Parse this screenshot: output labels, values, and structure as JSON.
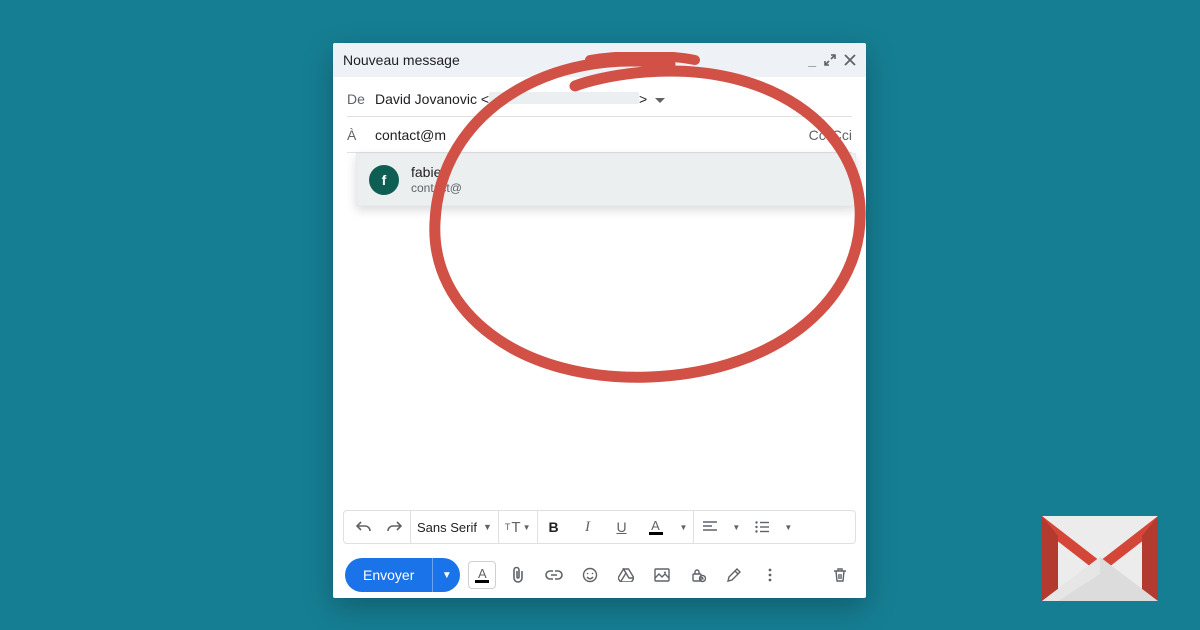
{
  "compose": {
    "title": "Nouveau message",
    "from_label": "De",
    "from_name": "David Jovanovic",
    "from_bracket_open": "<",
    "from_bracket_close": ">",
    "to_label": "À",
    "to_value": "contact@m",
    "cc_label": "Cc",
    "bcc_label": "Cci",
    "suggestion": {
      "avatar_initial": "f",
      "name": "fabien",
      "email_prefix": "contact@"
    },
    "font_name": "Sans Serif",
    "send_label": "Envoyer"
  },
  "icons": {
    "minimize": "_",
    "expand": "expand-icon",
    "close": "close-icon",
    "undo": "undo-icon",
    "redo": "redo-icon",
    "text_size": "text-size-icon",
    "bold": "B",
    "italic": "I",
    "underline": "U",
    "text_color": "A",
    "align": "align-icon",
    "list": "list-icon",
    "format_toggle": "A",
    "attach": "attach-icon",
    "link": "link-icon",
    "emoji": "emoji-icon",
    "drive": "drive-icon",
    "image": "image-icon",
    "confidential": "lock-clock-icon",
    "pen": "pen-icon",
    "more": "more-icon",
    "trash": "trash-icon"
  },
  "colors": {
    "background": "#167e93",
    "accent_blue": "#1a73e8",
    "annotation_red": "#d15147",
    "suggestion_avatar": "#0f5e54"
  }
}
